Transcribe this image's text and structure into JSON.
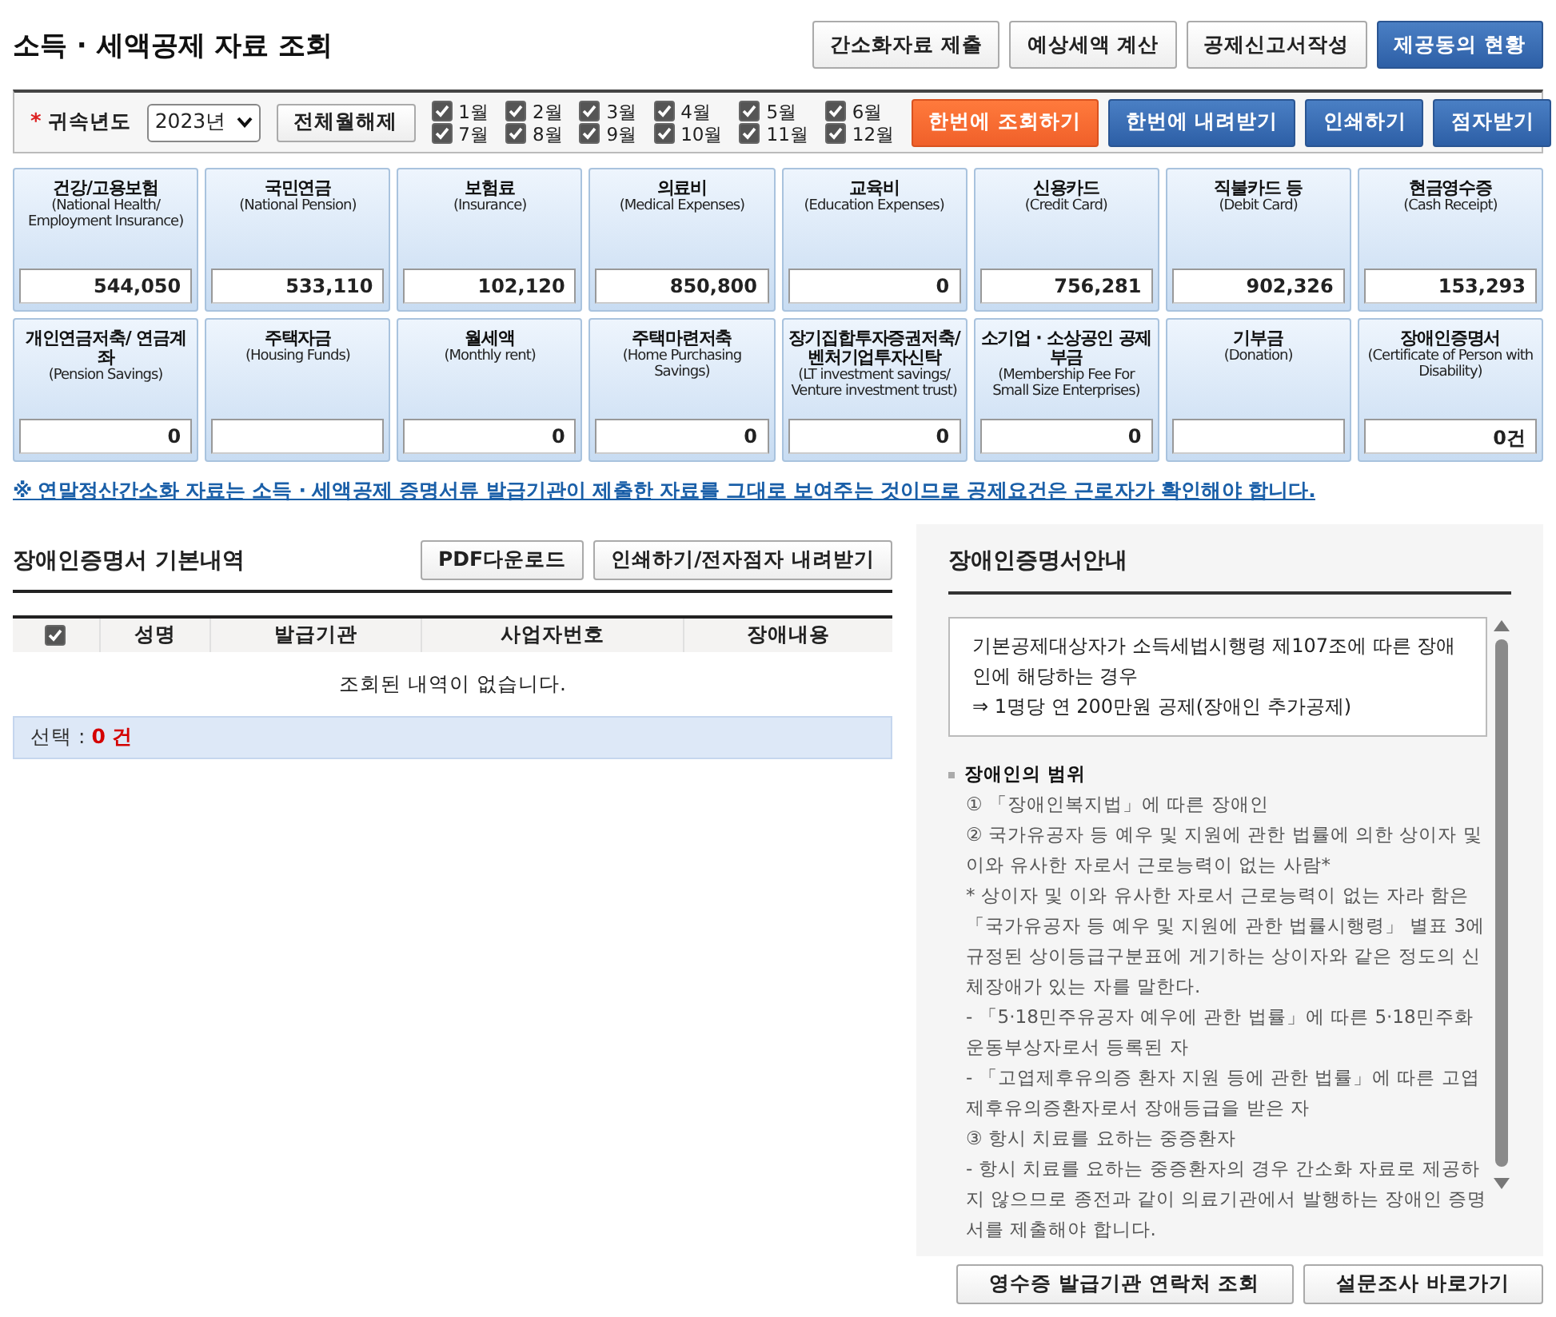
{
  "page_title": "소득 · 세액공제 자료 조회",
  "header_buttons": [
    {
      "label": "간소화자료 제출",
      "kind": "default"
    },
    {
      "label": "예상세액 계산",
      "kind": "default"
    },
    {
      "label": "공제신고서작성",
      "kind": "default"
    },
    {
      "label": "제공동의 현황",
      "kind": "primary"
    }
  ],
  "filter": {
    "required_mark": "*",
    "year_label": "귀속년도",
    "year_value": "2023년",
    "clear_button": "전체월해제",
    "months": [
      {
        "label": "1월",
        "checked": true
      },
      {
        "label": "2월",
        "checked": true
      },
      {
        "label": "3월",
        "checked": true
      },
      {
        "label": "4월",
        "checked": true
      },
      {
        "label": "5월",
        "checked": true
      },
      {
        "label": "6월",
        "checked": true
      },
      {
        "label": "7월",
        "checked": true
      },
      {
        "label": "8월",
        "checked": true
      },
      {
        "label": "9월",
        "checked": true
      },
      {
        "label": "10월",
        "checked": true
      },
      {
        "label": "11월",
        "checked": true
      },
      {
        "label": "12월",
        "checked": true
      }
    ],
    "actions": [
      {
        "label": "한번에 조회하기",
        "kind": "highlight"
      },
      {
        "label": "한번에 내려받기",
        "kind": "primary"
      },
      {
        "label": "인쇄하기",
        "kind": "primary"
      },
      {
        "label": "점자받기",
        "kind": "primary"
      }
    ]
  },
  "categories": [
    {
      "title": "건강/고용보험",
      "subtitle": "(National Health/ Employment Insurance)",
      "value": "544,050"
    },
    {
      "title": "국민연금",
      "subtitle": "(National Pension)",
      "value": "533,110"
    },
    {
      "title": "보험료",
      "subtitle": "(Insurance)",
      "value": "102,120"
    },
    {
      "title": "의료비",
      "subtitle": "(Medical Expenses)",
      "value": "850,800"
    },
    {
      "title": "교육비",
      "subtitle": "(Education Expenses)",
      "value": "0"
    },
    {
      "title": "신용카드",
      "subtitle": "(Credit Card)",
      "value": "756,281"
    },
    {
      "title": "직불카드 등",
      "subtitle": "(Debit Card)",
      "value": "902,326"
    },
    {
      "title": "현금영수증",
      "subtitle": "(Cash Receipt)",
      "value": "153,293"
    },
    {
      "title": "개인연금저축/ 연금계좌",
      "subtitle": "(Pension Savings)",
      "value": "0"
    },
    {
      "title": "주택자금",
      "subtitle": "(Housing Funds)"
    },
    {
      "title": "월세액",
      "subtitle": "(Monthly rent)",
      "value": "0"
    },
    {
      "title": "주택마련저축",
      "subtitle": "(Home Purchasing Savings)",
      "value": "0"
    },
    {
      "title": "장기집합투자증권저축/ 벤처기업투자신탁",
      "subtitle": "(LT investment savings/ Venture investment trust)",
      "value": "0"
    },
    {
      "title": "소기업 · 소상공인 공제부금",
      "subtitle": "(Membership Fee For Small Size Enterprises)",
      "value": "0"
    },
    {
      "title": "기부금",
      "subtitle": "(Donation)"
    },
    {
      "title": "장애인증명서",
      "subtitle": "(Certificate of Person with Disability)",
      "value": "0건"
    }
  ],
  "notice_link": "※ 연말정산간소화 자료는 소득 · 세액공제 증명서류 발급기관이 제출한 자료를 그대로 보여주는 것이므로 공제요건은 근로자가 확인해야 합니다.",
  "detail": {
    "title": "장애인증명서 기본내역",
    "buttons": [
      "PDF다운로드",
      "인쇄하기/전자점자 내려받기"
    ],
    "select_all_checked": true,
    "columns": [
      "성명",
      "발급기관",
      "사업자번호",
      "장애내용"
    ],
    "empty_message": "조회된 내역이 없습니다.",
    "summary_label": "선택 :",
    "summary_count": "0 건"
  },
  "guide": {
    "title": "장애인증명서안내",
    "box_lines": [
      "기본공제대상자가 소득세법시행령 제107조에 따른 장애인에 해당하는 경우",
      "⇒ 1명당 연 200만원 공제(장애인 추가공제)"
    ],
    "items": [
      {
        "kind": "heading",
        "text": "장애인의 범위"
      },
      {
        "kind": "text",
        "text": "① 「장애인복지법」에 따른 장애인"
      },
      {
        "kind": "text",
        "text": "② 국가유공자 등 예우 및 지원에 관한 법률에 의한 상이자 및 이와 유사한 자로서 근로능력이 없는 사람*"
      },
      {
        "kind": "text",
        "text": "* 상이자 및 이와 유사한 자로서 근로능력이 없는 자라 함은 「국가유공자 등 예우 및 지원에 관한 법률시행령」 별표 3에 규정된 상이등급구분표에 게기하는 상이자와 같은 정도의 신체장애가 있는 자를 말한다."
      },
      {
        "kind": "text",
        "text": "- 「5·18민주유공자 예우에 관한 법률」에 따른 5·18민주화운동부상자로서 등록된 자"
      },
      {
        "kind": "text",
        "text": "- 「고엽제후유의증 환자 지원 등에 관한 법률」에 따른 고엽제후유의증환자로서 장애등급을 받은 자"
      },
      {
        "kind": "text",
        "text": "③ 항시 치료를 요하는 중증환자"
      },
      {
        "kind": "text",
        "text": "- 항시 치료를 요하는 중증환자의 경우 간소화 자료로 제공하지 않으므로 종전과 같이 의료기관에서 발행하는 장애인 증명서를 제출해야 합니다."
      }
    ]
  },
  "footer_buttons": [
    "영수증 발급기관 연락처 조회",
    "설문조사 바로가기"
  ]
}
